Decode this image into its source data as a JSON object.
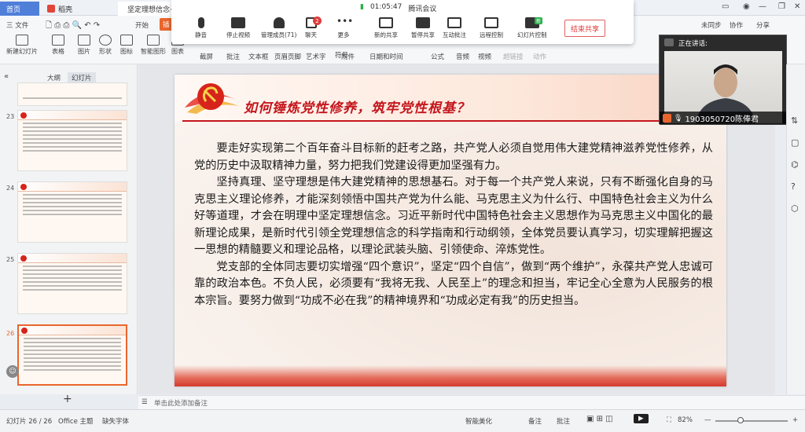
{
  "titlebar": {
    "home_tab": "首页",
    "daoke_tab": "稻壳",
    "doc_tab": "坚定理想信念·锤..."
  },
  "menubar": {
    "file_menu": "三 文件",
    "start_tab": "开始",
    "sync_label": "未同步",
    "collab_label": "协作",
    "share_label": "分享"
  },
  "ribbon": {
    "new_slide": "新建幻灯片",
    "table": "表格",
    "picture": "图片",
    "shape": "形状",
    "icon": "图标",
    "smart_graphic": "智能图形",
    "chart": "图表",
    "screenshot": "截屏",
    "annotate": "批注",
    "textbox": "文本框",
    "header_footer": "页眉页脚",
    "art_text": "艺术字",
    "symbol": "符号",
    "attachment": "附件",
    "datetime": "日期和时间",
    "formula": "公式",
    "audio": "音频",
    "video": "视频",
    "hyperlink": "超链接",
    "animation": "动作"
  },
  "meeting": {
    "timer": "01:05:47",
    "app_name": "腾讯会议",
    "controls": [
      {
        "label": "静音"
      },
      {
        "label": "停止视频"
      },
      {
        "label": "管理成员(71)"
      },
      {
        "label": "聊天"
      },
      {
        "label": "更多"
      },
      {
        "label": "新的共享"
      },
      {
        "label": "暂停共享"
      },
      {
        "label": "互动批注"
      },
      {
        "label": "远程控制"
      },
      {
        "label": "幻灯片控制"
      }
    ],
    "chat_badge": "2",
    "new_badge": "新",
    "end_share": "结束共享"
  },
  "left_panel": {
    "outline_tab": "大纲",
    "slides_tab": "幻灯片",
    "thumbnails": [
      {
        "num": "23"
      },
      {
        "num": "24"
      },
      {
        "num": "25"
      },
      {
        "num": "26"
      }
    ]
  },
  "slide": {
    "title": "如何锤炼党性修养，筑牢党性根基？",
    "paragraphs": [
      "要走好实现第二个百年奋斗目标新的赶考之路，共产党人必须自觉用伟大建党精神滋养党性修养，从党的历史中汲取精神力量，努力把我们党建设得更加坚强有力。",
      "坚持真理、坚守理想是伟大建党精神的思想基石。对于每一个共产党人来说，只有不断强化自身的马克思主义理论修养，才能深刻领悟中国共产党为什么能、马克思主义为什么行、中国特色社会主义为什么好等道理，才会在明理中坚定理想信念。习近平新时代中国特色社会主义思想作为马克思主义中国化的最新理论成果，是新时代引领全党理想信念的科学指南和行动纲领，全体党员要认真学习，切实理解把握这一思想的精髓要义和理论品格，以理论武装头脑、引领使命、淬炼党性。",
      "党支部的全体同志要切实增强“四个意识”，坚定“四个自信”，做到“两个维护”，永葆共产党人忠诚可靠的政治本色。不负人民，必须要有“我将无我、人民至上”的理念和担当，牢记全心全意为人民服务的根本宗旨。要努力做到“功成不必在我”的精神境界和“功成必定有我”的历史担当。"
    ]
  },
  "video": {
    "speaking_label": "正在讲话:",
    "speaker_name": "1903050720陈俸君"
  },
  "notes": {
    "placeholder": "单击此处添加备注"
  },
  "statusbar": {
    "slide_counter": "幻灯片 26 / 26",
    "theme": "Office 主题",
    "missing_font": "缺失字体",
    "smart_beautify": "智能美化",
    "notes_btn": "备注",
    "comments_btn": "批注",
    "zoom": "82%"
  }
}
